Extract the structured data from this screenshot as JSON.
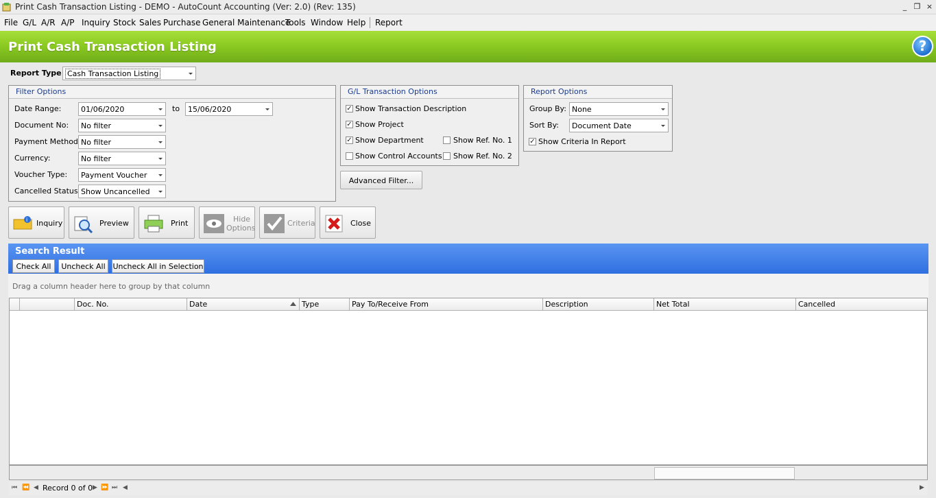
{
  "window": {
    "title": "Print Cash Transaction Listing - DEMO - AutoCount Accounting (Ver: 2.0) (Rev: 135)",
    "minimize": "_",
    "restore": "❐",
    "close": "×"
  },
  "menu": [
    "File",
    "G/L",
    "A/R",
    "A/P",
    "Inquiry",
    "Stock",
    "Sales",
    "Purchase",
    "General Maintenance",
    "Tools",
    "Window",
    "Help",
    "Report"
  ],
  "header": {
    "title": "Print Cash Transaction Listing",
    "help": "?"
  },
  "report_type": {
    "label": "Report Type",
    "value": "Cash Transaction Listing"
  },
  "filter_options": {
    "title": "Filter Options",
    "date_range_label": "Date Range:",
    "date_from": "01/06/2020",
    "to_label": "to",
    "date_to": "15/06/2020",
    "document_no_label": "Document No:",
    "document_no": "No filter",
    "payment_method_label": "Payment Method:",
    "payment_method": "No filter",
    "currency_label": "Currency:",
    "currency": "No filter",
    "voucher_type_label": "Voucher Type:",
    "voucher_type": "Payment Voucher",
    "cancelled_status_label": "Cancelled Status:",
    "cancelled_status": "Show Uncancelled"
  },
  "gl_options": {
    "title": "G/L Transaction Options",
    "show_transaction_description": "Show Transaction Description",
    "show_project": "Show Project",
    "show_department": "Show Department",
    "show_control_accounts": "Show Control Accounts",
    "show_ref_no_1": "Show Ref. No. 1",
    "show_ref_no_2": "Show Ref. No. 2",
    "checked": {
      "show_transaction_description": true,
      "show_project": true,
      "show_department": true,
      "show_control_accounts": false,
      "show_ref_no_1": false,
      "show_ref_no_2": false
    }
  },
  "advanced_filter": "Advanced Filter...",
  "report_options": {
    "title": "Report Options",
    "group_by_label": "Group By:",
    "group_by": "None",
    "sort_by_label": "Sort By:",
    "sort_by": "Document Date",
    "show_criteria": "Show Criteria In Report",
    "show_criteria_checked": true
  },
  "toolbar": {
    "inquiry": "Inquiry",
    "preview": "Preview",
    "print": "Print",
    "hide_options_1": "Hide",
    "hide_options_2": "Options",
    "criteria": "Criteria",
    "close": "Close"
  },
  "search_result": {
    "title": "Search Result",
    "check_all": "Check All",
    "uncheck_all": "Uncheck All",
    "uncheck_all_in_selection": "Uncheck All in Selection",
    "group_hint": "Drag a column header here to group by that column"
  },
  "grid": {
    "columns": [
      "Doc. No.",
      "Date",
      "Type",
      "Pay To/Receive From",
      "Description",
      "Net Total",
      "Cancelled"
    ],
    "rows": []
  },
  "navigator": {
    "record": "Record 0 of 0"
  },
  "colors": {
    "header_green": "#8ccb22",
    "search_blue": "#3a79e8",
    "group_title": "#1a3c8f"
  }
}
